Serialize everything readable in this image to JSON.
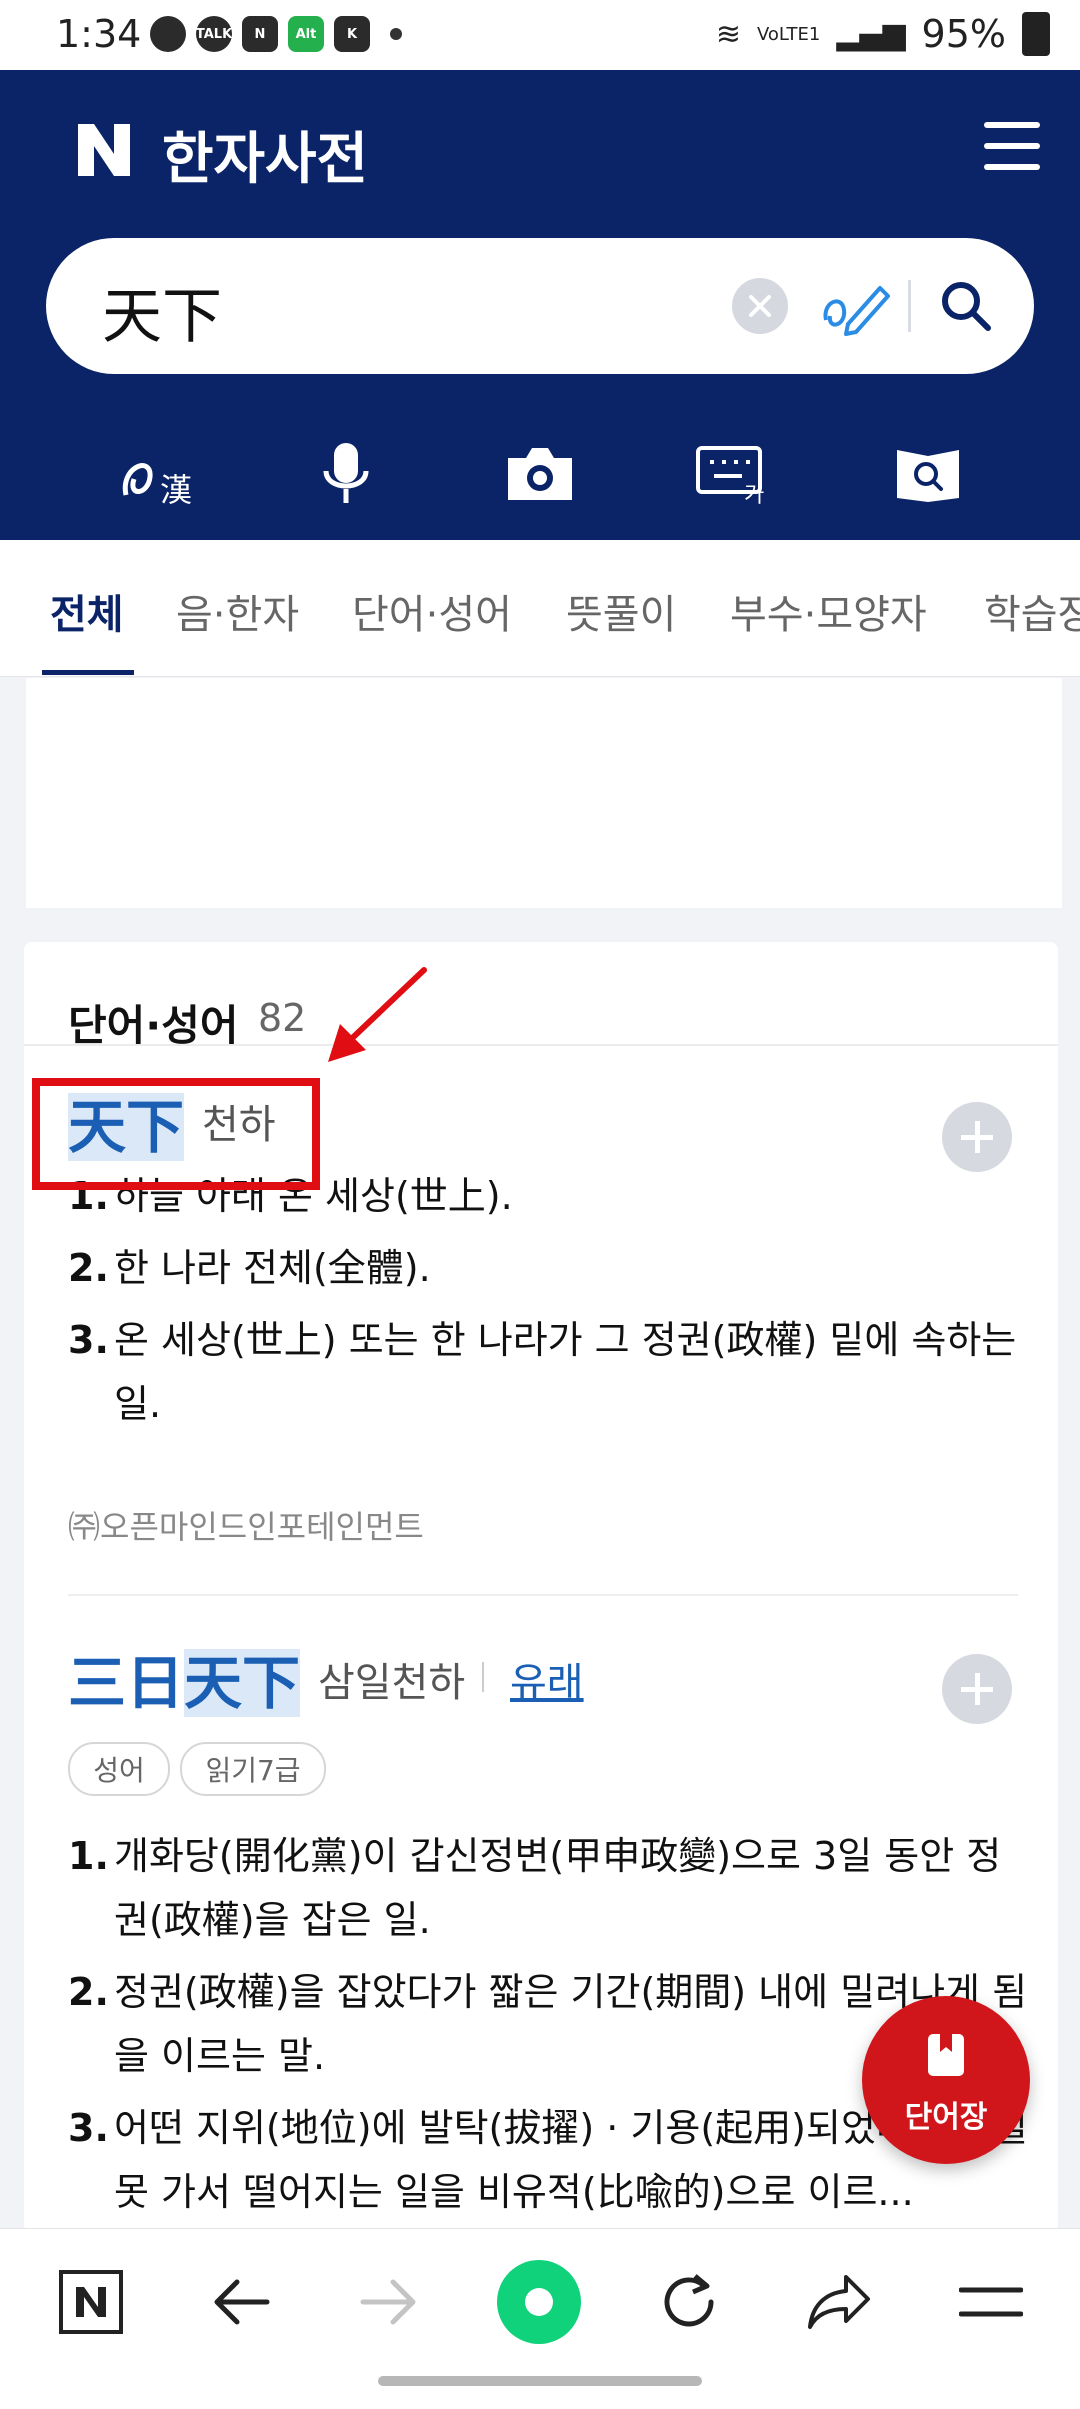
{
  "status_bar": {
    "time": "1:34",
    "notification_icons": [
      "chat-icon",
      "talk-icon",
      "naver-icon",
      "alt-icon",
      "kbank-icon"
    ],
    "battery": "95%",
    "network": "VoLTE1"
  },
  "header": {
    "logo": "N",
    "title": "한자사전",
    "search_query": "天下"
  },
  "tools": [
    "handwriting-hanja-icon",
    "microphone-icon",
    "camera-icon",
    "keyboard-icon",
    "book-search-icon"
  ],
  "tabs": [
    {
      "label": "전체",
      "active": true
    },
    {
      "label": "음·한자"
    },
    {
      "label": "단어·성어"
    },
    {
      "label": "뜻풀이"
    },
    {
      "label": "부수·모양자"
    },
    {
      "label": "학습장"
    }
  ],
  "section": {
    "title": "단어·성어",
    "count": "82"
  },
  "entries": [
    {
      "hanja": "天下",
      "reading": "천하",
      "definitions": [
        "하늘 아래 온 세상(世上).",
        "한 나라 전체(全體).",
        "온 세상(世上) 또는 한 나라가 그 정권(政權) 밑에 속하는 일."
      ],
      "source": "㈜오픈마인드인포테인먼트"
    },
    {
      "hanja_prefix": "三日",
      "hanja_highlight": "天下",
      "reading": "삼일천하",
      "origin_link": "유래",
      "badges": [
        "성어",
        "읽기7급"
      ],
      "definitions": [
        "개화당(開化黨)이 갑신정변(甲申政變)으로 3일 동안 정권(政權)을 잡은 일.",
        "정권(政權)을 잡았다가 짧은 기간(期間) 내에 밀려나게 됨을 이르는 말.",
        "어떤 지위(地位)에 발탁(拔擢) · 기용(起用)되었다가 며칠 못 가서 떨어지는 일을 비유적(比喩的)으로 이르..."
      ]
    }
  ],
  "fab": {
    "label": "단어장"
  },
  "bottom_nav": [
    "naver-home-icon",
    "back-arrow-icon",
    "forward-arrow-icon",
    "green-dot-icon",
    "refresh-icon",
    "share-icon",
    "menu-icon"
  ],
  "colors": {
    "header": "#0b2367",
    "accent": "#1a5fb4",
    "highlight_box": "#e00d13",
    "fab": "#d1161b"
  }
}
